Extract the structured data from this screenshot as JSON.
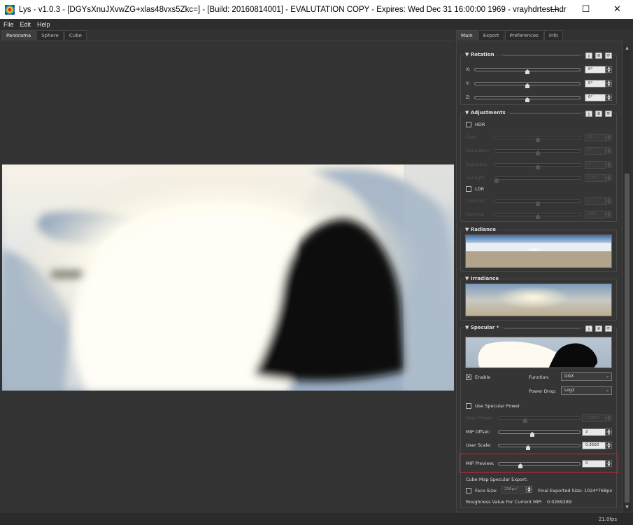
{
  "window": {
    "title": "Lys - v1.0.3 - [DGYsXnuJXvwZG+xlas48vxs5Zkc=] - [Build: 20160814001] - EVALUTATION COPY - Expires: Wed Dec 31 16:00:00 1969 - vrayhdrtest.hdr",
    "minimize": "—",
    "maximize": "☐",
    "close": "✕"
  },
  "menu": [
    "File",
    "Edit",
    "Help"
  ],
  "view_tabs": [
    "Panorama",
    "Sphere",
    "Cube"
  ],
  "panel_tabs": [
    "Main",
    "Export",
    "Preferences",
    "Info"
  ],
  "rotation": {
    "title": "Rotation",
    "rows": [
      {
        "label": "X:",
        "value": "0°",
        "pos": 0.5
      },
      {
        "label": "Y:",
        "value": "0°",
        "pos": 0.5
      },
      {
        "label": "Z:",
        "value": "0°",
        "pos": 0.5
      }
    ]
  },
  "adjustments": {
    "title": "Adjustments",
    "hdr_label": "HDR",
    "hdr_rows": [
      {
        "label": "Gain",
        "value": "10",
        "pos": 0.5
      },
      {
        "label": "Saturation",
        "value": "0",
        "pos": 0.5
      },
      {
        "label": "Exposure",
        "value": "0",
        "pos": 0.5
      },
      {
        "label": "Sunlight",
        "value": "0.00",
        "pos": 0.0
      }
    ],
    "ldr_label": "LDR",
    "ldr_rows": [
      {
        "label": "Contrast",
        "value": "0",
        "pos": 0.5
      },
      {
        "label": "Gamma",
        "value": "100",
        "pos": 0.5
      }
    ]
  },
  "radiance": {
    "title": "Radiance"
  },
  "irradiance": {
    "title": "Irradiance"
  },
  "specular": {
    "title": "Specular *",
    "enable_label": "Enable",
    "enable_checked": "✕",
    "function_label": "Function:",
    "function_value": "GGX",
    "power_drop_label": "Power Drop:",
    "power_drop_value": "Log2",
    "use_specular_power_label": "Use Specular Power",
    "specular_power": {
      "label": "Spec Power",
      "value": "0.0000",
      "pos": 0.5
    },
    "mip_offset": {
      "label": "MIP Offset:",
      "value": "2",
      "pos": 0.42
    },
    "user_scale": {
      "label": "User Scale:",
      "value": "0.3500",
      "pos": 0.35
    },
    "mip_preview": {
      "label": "MIP Preview:",
      "value": "0",
      "pos": 0.25
    },
    "cube_map_label": "Cube Map Specular Export:",
    "face_size_label": "Face Size:",
    "face_size_value": "256px²",
    "final_size_label": "Final Exported Size:",
    "final_size_value": "1024*768px",
    "roughness_label": "Roughness Value For Current MIP:",
    "roughness_value": "0.0269289"
  },
  "group_buttons": [
    "⤓",
    "⊘",
    "⟳"
  ],
  "status": {
    "fps": "21.0fps"
  }
}
